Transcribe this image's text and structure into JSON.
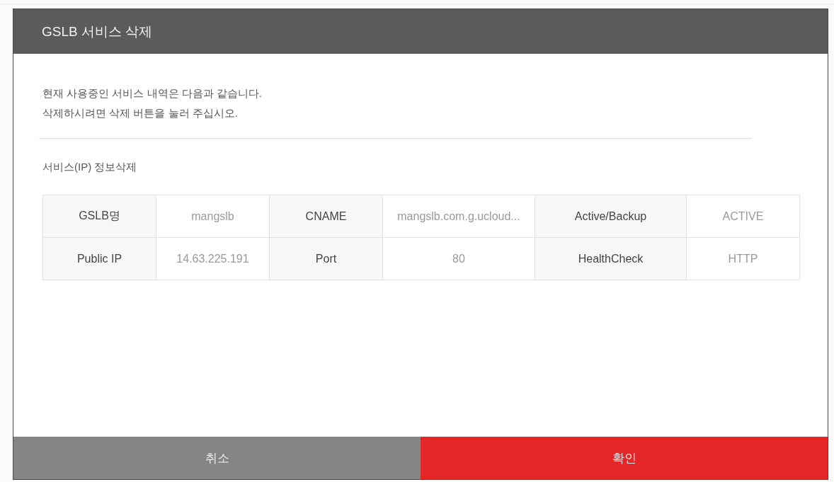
{
  "dialog": {
    "title": "GSLB 서비스 삭제",
    "message": [
      "현재 사용중인 서비스 내역은 다음과 같습니다.",
      "삭제하시려면 삭제 버튼을 눌러 주십시오."
    ],
    "section_title": "서비스(IP) 정보삭제",
    "table": {
      "rows": [
        [
          {
            "kind": "label",
            "text": "GSLB명"
          },
          {
            "kind": "value",
            "text": "mangslb"
          },
          {
            "kind": "label",
            "text": "CNAME"
          },
          {
            "kind": "value",
            "text": "mangslb.com.g.ucloud..."
          },
          {
            "kind": "label",
            "text": "Active/Backup"
          },
          {
            "kind": "value",
            "text": "ACTIVE"
          }
        ],
        [
          {
            "kind": "label",
            "text": "Public IP"
          },
          {
            "kind": "value",
            "text": "14.63.225.191"
          },
          {
            "kind": "label",
            "text": "Port"
          },
          {
            "kind": "value",
            "text": "80"
          },
          {
            "kind": "label",
            "text": "HealthCheck"
          },
          {
            "kind": "value",
            "text": "HTTP"
          }
        ]
      ]
    },
    "buttons": [
      {
        "kind": "cancel",
        "label": "취소"
      },
      {
        "kind": "confirm",
        "label": "확인"
      }
    ]
  }
}
